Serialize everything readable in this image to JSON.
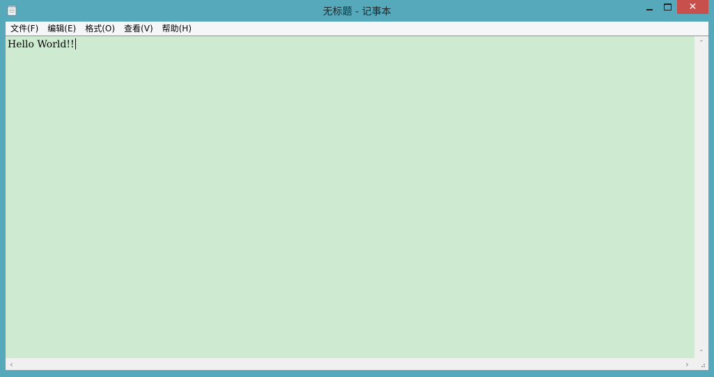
{
  "window": {
    "title": "无标题 - 记事本",
    "close_glyph": "✕",
    "frame_color": "#55a9bb",
    "close_color": "#c7504c"
  },
  "menu": {
    "items": [
      "文件(F)",
      "编辑(E)",
      "格式(O)",
      "查看(V)",
      "帮助(H)"
    ]
  },
  "editor": {
    "text": "Hello World!!",
    "background": "#ceead1"
  },
  "scrollbars": {
    "up": "⌃",
    "down": "⌄",
    "left": "‹",
    "right": "›"
  },
  "icons": {
    "app": "notepad-icon",
    "minimize": "minimize-icon",
    "maximize": "maximize-icon",
    "close": "close-icon",
    "grip": "size-grip-icon"
  }
}
